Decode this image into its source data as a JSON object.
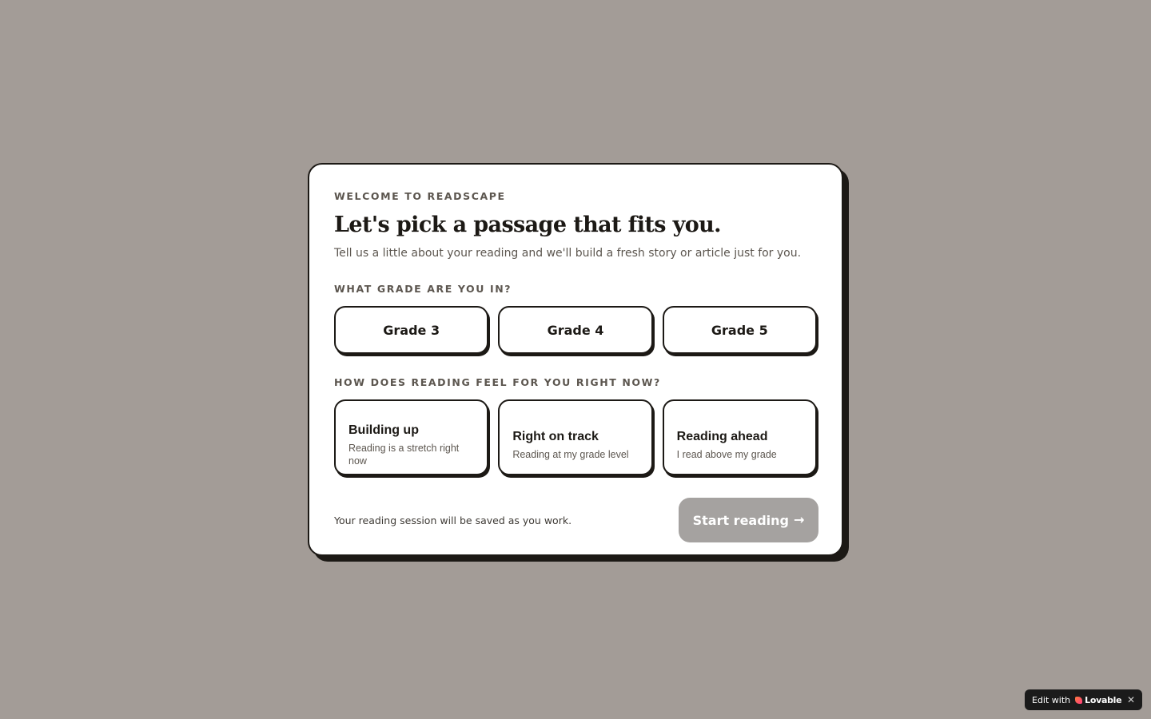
{
  "onboarding": {
    "eyebrow": "WELCOME TO READSCAPE",
    "title": "Let's pick a passage that fits you.",
    "subtitle": "Tell us a little about your reading and we'll build a fresh story or article just for you.",
    "grade_question": "WHAT GRADE ARE YOU IN?",
    "grades": [
      {
        "label": "Grade 3"
      },
      {
        "label": "Grade 4"
      },
      {
        "label": "Grade 5"
      }
    ],
    "feel_question": "HOW DOES READING FEEL FOR YOU RIGHT NOW?",
    "levels": [
      {
        "title": "Building up",
        "description": "Reading is a stretch right now"
      },
      {
        "title": "Right on track",
        "description": "Reading at my grade level"
      },
      {
        "title": "Reading ahead",
        "description": "I read above my grade"
      }
    ],
    "footer_note": "Your reading session will be saved as you work.",
    "start_label": "Start reading",
    "start_icon": "arrow-right-icon",
    "start_enabled": false
  },
  "badge": {
    "prefix": "Edit with",
    "brand": "Lovable",
    "icon": "lovable-heart-icon",
    "close_icon": "close-icon"
  },
  "colors": {
    "background": "#a39c97",
    "card": "#ffffff",
    "ink": "#1c1915",
    "muted_text": "#5c564f",
    "disabled_button": "#a5a2a0",
    "badge_bg": "#1b1b1b"
  }
}
